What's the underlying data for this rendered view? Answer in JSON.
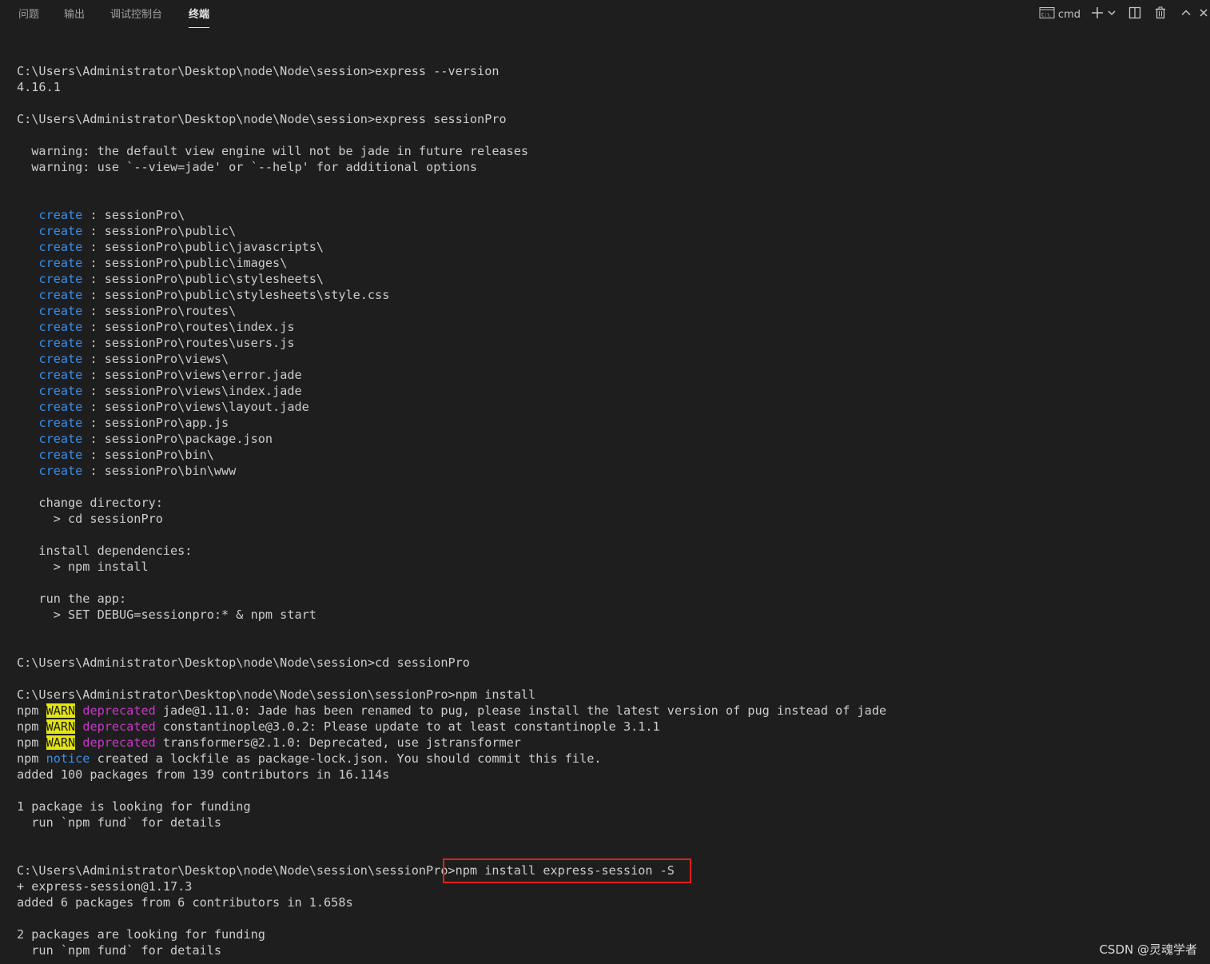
{
  "tabs": [
    {
      "label": "问题",
      "active": false
    },
    {
      "label": "输出",
      "active": false
    },
    {
      "label": "调试控制台",
      "active": false
    },
    {
      "label": "终端",
      "active": true
    }
  ],
  "toolbar": {
    "shell_label": "cmd",
    "icons": [
      "terminal-icon",
      "plus-icon",
      "chevron-down-icon",
      "split-icon",
      "trash-icon",
      "chevron-up-icon",
      "close-icon"
    ]
  },
  "colors": {
    "background": "#1e1e1e",
    "text": "#cccccc",
    "create": "#3b8eea",
    "deprecated": "#c739c5",
    "warn_bg": "#e5e510",
    "highlight_box": "#e0201c"
  },
  "terminal": {
    "lines": [
      [
        {
          "t": "C:\\Users\\Administrator\\Desktop\\node\\Node\\session>express --version"
        }
      ],
      [
        {
          "t": "4.16.1"
        }
      ],
      [],
      [
        {
          "t": "C:\\Users\\Administrator\\Desktop\\node\\Node\\session>express sessionPro"
        }
      ],
      [],
      [
        {
          "t": "  warning: the default view engine will not be jade in future releases"
        }
      ],
      [
        {
          "t": "  warning: use `--view=jade' or `--help' for additional options"
        }
      ],
      [],
      [],
      [
        {
          "t": "   "
        },
        {
          "t": "create",
          "c": "blue"
        },
        {
          "t": " : sessionPro\\"
        }
      ],
      [
        {
          "t": "   "
        },
        {
          "t": "create",
          "c": "blue"
        },
        {
          "t": " : sessionPro\\public\\"
        }
      ],
      [
        {
          "t": "   "
        },
        {
          "t": "create",
          "c": "blue"
        },
        {
          "t": " : sessionPro\\public\\javascripts\\"
        }
      ],
      [
        {
          "t": "   "
        },
        {
          "t": "create",
          "c": "blue"
        },
        {
          "t": " : sessionPro\\public\\images\\"
        }
      ],
      [
        {
          "t": "   "
        },
        {
          "t": "create",
          "c": "blue"
        },
        {
          "t": " : sessionPro\\public\\stylesheets\\"
        }
      ],
      [
        {
          "t": "   "
        },
        {
          "t": "create",
          "c": "blue"
        },
        {
          "t": " : sessionPro\\public\\stylesheets\\style.css"
        }
      ],
      [
        {
          "t": "   "
        },
        {
          "t": "create",
          "c": "blue"
        },
        {
          "t": " : sessionPro\\routes\\"
        }
      ],
      [
        {
          "t": "   "
        },
        {
          "t": "create",
          "c": "blue"
        },
        {
          "t": " : sessionPro\\routes\\index.js"
        }
      ],
      [
        {
          "t": "   "
        },
        {
          "t": "create",
          "c": "blue"
        },
        {
          "t": " : sessionPro\\routes\\users.js"
        }
      ],
      [
        {
          "t": "   "
        },
        {
          "t": "create",
          "c": "blue"
        },
        {
          "t": " : sessionPro\\views\\"
        }
      ],
      [
        {
          "t": "   "
        },
        {
          "t": "create",
          "c": "blue"
        },
        {
          "t": " : sessionPro\\views\\error.jade"
        }
      ],
      [
        {
          "t": "   "
        },
        {
          "t": "create",
          "c": "blue"
        },
        {
          "t": " : sessionPro\\views\\index.jade"
        }
      ],
      [
        {
          "t": "   "
        },
        {
          "t": "create",
          "c": "blue"
        },
        {
          "t": " : sessionPro\\views\\layout.jade"
        }
      ],
      [
        {
          "t": "   "
        },
        {
          "t": "create",
          "c": "blue"
        },
        {
          "t": " : sessionPro\\app.js"
        }
      ],
      [
        {
          "t": "   "
        },
        {
          "t": "create",
          "c": "blue"
        },
        {
          "t": " : sessionPro\\package.json"
        }
      ],
      [
        {
          "t": "   "
        },
        {
          "t": "create",
          "c": "blue"
        },
        {
          "t": " : sessionPro\\bin\\"
        }
      ],
      [
        {
          "t": "   "
        },
        {
          "t": "create",
          "c": "blue"
        },
        {
          "t": " : sessionPro\\bin\\www"
        }
      ],
      [],
      [
        {
          "t": "   change directory:"
        }
      ],
      [
        {
          "t": "     > cd sessionPro"
        }
      ],
      [],
      [
        {
          "t": "   install dependencies:"
        }
      ],
      [
        {
          "t": "     > npm install"
        }
      ],
      [],
      [
        {
          "t": "   run the app:"
        }
      ],
      [
        {
          "t": "     > SET DEBUG=sessionpro:* & npm start"
        }
      ],
      [],
      [],
      [
        {
          "t": "C:\\Users\\Administrator\\Desktop\\node\\Node\\session>cd sessionPro"
        }
      ],
      [],
      [
        {
          "t": "C:\\Users\\Administrator\\Desktop\\node\\Node\\session\\sessionPro>npm install"
        }
      ],
      [
        {
          "t": "npm "
        },
        {
          "t": "WARN",
          "c": "warn"
        },
        {
          "t": " "
        },
        {
          "t": "deprecated",
          "c": "magenta"
        },
        {
          "t": " jade@1.11.0: Jade has been renamed to pug, please install the latest version of pug instead of jade"
        }
      ],
      [
        {
          "t": "npm "
        },
        {
          "t": "WARN",
          "c": "warn"
        },
        {
          "t": " "
        },
        {
          "t": "deprecated",
          "c": "magenta"
        },
        {
          "t": " constantinople@3.0.2: Please update to at least constantinople 3.1.1"
        }
      ],
      [
        {
          "t": "npm "
        },
        {
          "t": "WARN",
          "c": "warn"
        },
        {
          "t": " "
        },
        {
          "t": "deprecated",
          "c": "magenta"
        },
        {
          "t": " transformers@2.1.0: Deprecated, use jstransformer"
        }
      ],
      [
        {
          "t": "npm "
        },
        {
          "t": "notice",
          "c": "blue"
        },
        {
          "t": " created a lockfile as package-lock.json. You should commit this file."
        }
      ],
      [
        {
          "t": "added 100 packages from 139 contributors in 16.114s"
        }
      ],
      [],
      [
        {
          "t": "1 package is looking for funding"
        }
      ],
      [
        {
          "t": "  run `npm fund` for details"
        }
      ],
      [],
      [],
      [
        {
          "t": "C:\\Users\\Administrator\\Desktop\\node\\Node\\session\\sessionPro>npm install express-session -S"
        }
      ],
      [
        {
          "t": "+ express-session@1.17.3"
        }
      ],
      [
        {
          "t": "added 6 packages from 6 contributors in 1.658s"
        }
      ],
      [],
      [
        {
          "t": "2 packages are looking for funding"
        }
      ],
      [
        {
          "t": "  run `npm fund` for details"
        }
      ]
    ]
  },
  "watermark": "CSDN @灵魂学者"
}
